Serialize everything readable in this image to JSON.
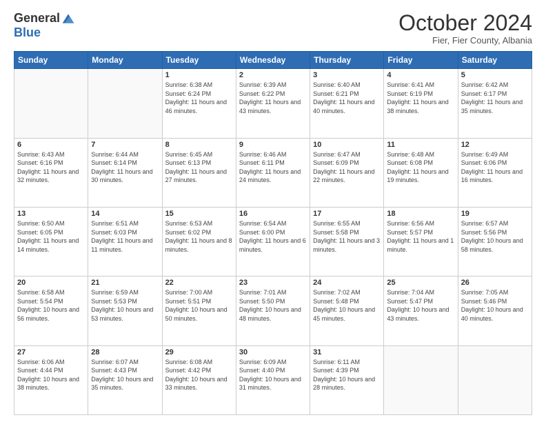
{
  "logo": {
    "general": "General",
    "blue": "Blue"
  },
  "header": {
    "month": "October 2024",
    "location": "Fier, Fier County, Albania"
  },
  "days_of_week": [
    "Sunday",
    "Monday",
    "Tuesday",
    "Wednesday",
    "Thursday",
    "Friday",
    "Saturday"
  ],
  "weeks": [
    [
      {
        "day": "",
        "info": ""
      },
      {
        "day": "",
        "info": ""
      },
      {
        "day": "1",
        "info": "Sunrise: 6:38 AM\nSunset: 6:24 PM\nDaylight: 11 hours and 46 minutes."
      },
      {
        "day": "2",
        "info": "Sunrise: 6:39 AM\nSunset: 6:22 PM\nDaylight: 11 hours and 43 minutes."
      },
      {
        "day": "3",
        "info": "Sunrise: 6:40 AM\nSunset: 6:21 PM\nDaylight: 11 hours and 40 minutes."
      },
      {
        "day": "4",
        "info": "Sunrise: 6:41 AM\nSunset: 6:19 PM\nDaylight: 11 hours and 38 minutes."
      },
      {
        "day": "5",
        "info": "Sunrise: 6:42 AM\nSunset: 6:17 PM\nDaylight: 11 hours and 35 minutes."
      }
    ],
    [
      {
        "day": "6",
        "info": "Sunrise: 6:43 AM\nSunset: 6:16 PM\nDaylight: 11 hours and 32 minutes."
      },
      {
        "day": "7",
        "info": "Sunrise: 6:44 AM\nSunset: 6:14 PM\nDaylight: 11 hours and 30 minutes."
      },
      {
        "day": "8",
        "info": "Sunrise: 6:45 AM\nSunset: 6:13 PM\nDaylight: 11 hours and 27 minutes."
      },
      {
        "day": "9",
        "info": "Sunrise: 6:46 AM\nSunset: 6:11 PM\nDaylight: 11 hours and 24 minutes."
      },
      {
        "day": "10",
        "info": "Sunrise: 6:47 AM\nSunset: 6:09 PM\nDaylight: 11 hours and 22 minutes."
      },
      {
        "day": "11",
        "info": "Sunrise: 6:48 AM\nSunset: 6:08 PM\nDaylight: 11 hours and 19 minutes."
      },
      {
        "day": "12",
        "info": "Sunrise: 6:49 AM\nSunset: 6:06 PM\nDaylight: 11 hours and 16 minutes."
      }
    ],
    [
      {
        "day": "13",
        "info": "Sunrise: 6:50 AM\nSunset: 6:05 PM\nDaylight: 11 hours and 14 minutes."
      },
      {
        "day": "14",
        "info": "Sunrise: 6:51 AM\nSunset: 6:03 PM\nDaylight: 11 hours and 11 minutes."
      },
      {
        "day": "15",
        "info": "Sunrise: 6:53 AM\nSunset: 6:02 PM\nDaylight: 11 hours and 8 minutes."
      },
      {
        "day": "16",
        "info": "Sunrise: 6:54 AM\nSunset: 6:00 PM\nDaylight: 11 hours and 6 minutes."
      },
      {
        "day": "17",
        "info": "Sunrise: 6:55 AM\nSunset: 5:58 PM\nDaylight: 11 hours and 3 minutes."
      },
      {
        "day": "18",
        "info": "Sunrise: 6:56 AM\nSunset: 5:57 PM\nDaylight: 11 hours and 1 minute."
      },
      {
        "day": "19",
        "info": "Sunrise: 6:57 AM\nSunset: 5:56 PM\nDaylight: 10 hours and 58 minutes."
      }
    ],
    [
      {
        "day": "20",
        "info": "Sunrise: 6:58 AM\nSunset: 5:54 PM\nDaylight: 10 hours and 56 minutes."
      },
      {
        "day": "21",
        "info": "Sunrise: 6:59 AM\nSunset: 5:53 PM\nDaylight: 10 hours and 53 minutes."
      },
      {
        "day": "22",
        "info": "Sunrise: 7:00 AM\nSunset: 5:51 PM\nDaylight: 10 hours and 50 minutes."
      },
      {
        "day": "23",
        "info": "Sunrise: 7:01 AM\nSunset: 5:50 PM\nDaylight: 10 hours and 48 minutes."
      },
      {
        "day": "24",
        "info": "Sunrise: 7:02 AM\nSunset: 5:48 PM\nDaylight: 10 hours and 45 minutes."
      },
      {
        "day": "25",
        "info": "Sunrise: 7:04 AM\nSunset: 5:47 PM\nDaylight: 10 hours and 43 minutes."
      },
      {
        "day": "26",
        "info": "Sunrise: 7:05 AM\nSunset: 5:46 PM\nDaylight: 10 hours and 40 minutes."
      }
    ],
    [
      {
        "day": "27",
        "info": "Sunrise: 6:06 AM\nSunset: 4:44 PM\nDaylight: 10 hours and 38 minutes."
      },
      {
        "day": "28",
        "info": "Sunrise: 6:07 AM\nSunset: 4:43 PM\nDaylight: 10 hours and 35 minutes."
      },
      {
        "day": "29",
        "info": "Sunrise: 6:08 AM\nSunset: 4:42 PM\nDaylight: 10 hours and 33 minutes."
      },
      {
        "day": "30",
        "info": "Sunrise: 6:09 AM\nSunset: 4:40 PM\nDaylight: 10 hours and 31 minutes."
      },
      {
        "day": "31",
        "info": "Sunrise: 6:11 AM\nSunset: 4:39 PM\nDaylight: 10 hours and 28 minutes."
      },
      {
        "day": "",
        "info": ""
      },
      {
        "day": "",
        "info": ""
      }
    ]
  ]
}
